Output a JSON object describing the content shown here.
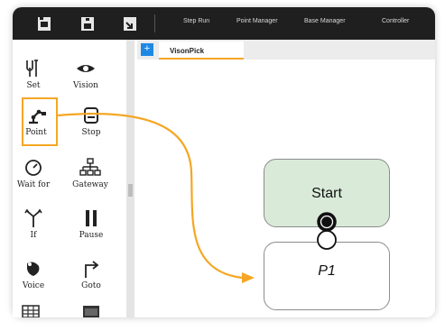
{
  "toolbar": {
    "menu": [
      "Step Run",
      "Point Manager",
      "Base Manager",
      "Controller"
    ]
  },
  "tools": {
    "set": "Set",
    "vision": "Vision",
    "point": "Point",
    "stop": "Stop",
    "wait_for": "Wait for",
    "gateway": "Gateway",
    "if": "If",
    "pause": "Pause",
    "voice": "Voice",
    "goto": "Goto"
  },
  "tabs": {
    "add_label": "+",
    "active": "VisonPick"
  },
  "flow": {
    "start_label": "Start",
    "p1_label": "P1"
  },
  "colors": {
    "highlight": "#f5a623",
    "start_fill": "#d9ead9",
    "tab_plus": "#1e88e5",
    "toolbar_bg": "#1f1f1f"
  }
}
